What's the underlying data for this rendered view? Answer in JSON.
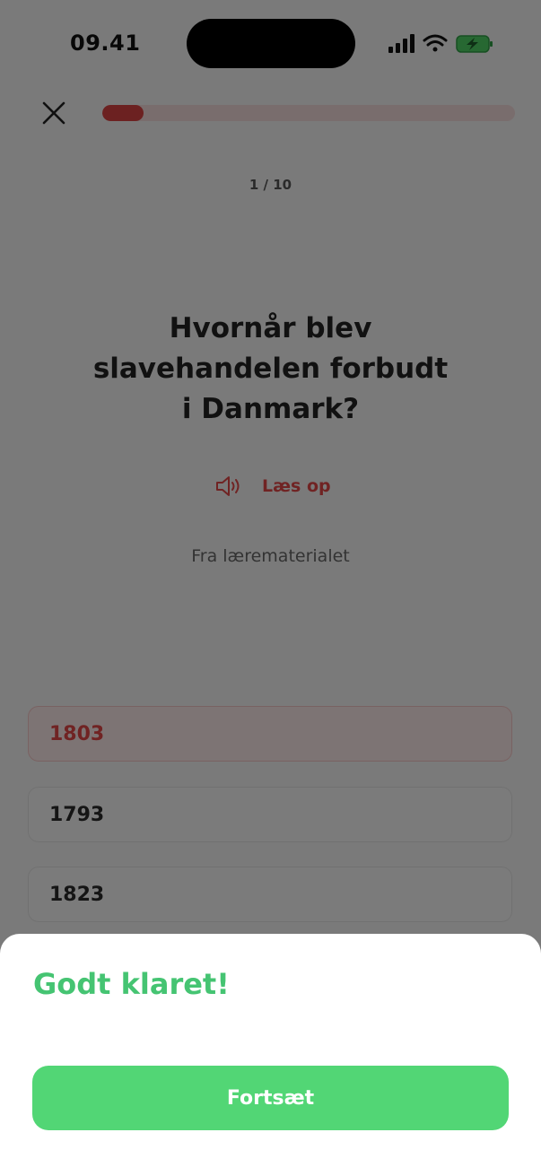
{
  "status_bar": {
    "time": "09.41"
  },
  "quiz": {
    "progress_fraction": 0.1,
    "counter": "1 / 10",
    "question": "Hvornår blev slavehandelen forbudt i Danmark?",
    "read_aloud_label": "Læs op",
    "source_label": "Fra lærematerialet",
    "answers": [
      {
        "label": "1803",
        "selected": true
      },
      {
        "label": "1793",
        "selected": false
      },
      {
        "label": "1823",
        "selected": false
      }
    ]
  },
  "result_sheet": {
    "title": "Godt klaret!",
    "continue_label": "Fortsæt"
  },
  "colors": {
    "accent_red": "#e04747",
    "success_green": "#45c472",
    "button_green": "#52d675"
  },
  "icons": {
    "close": "close-icon",
    "speaker": "speaker-icon",
    "signal": "cellular-signal-icon",
    "wifi": "wifi-icon",
    "battery": "battery-charging-icon"
  }
}
